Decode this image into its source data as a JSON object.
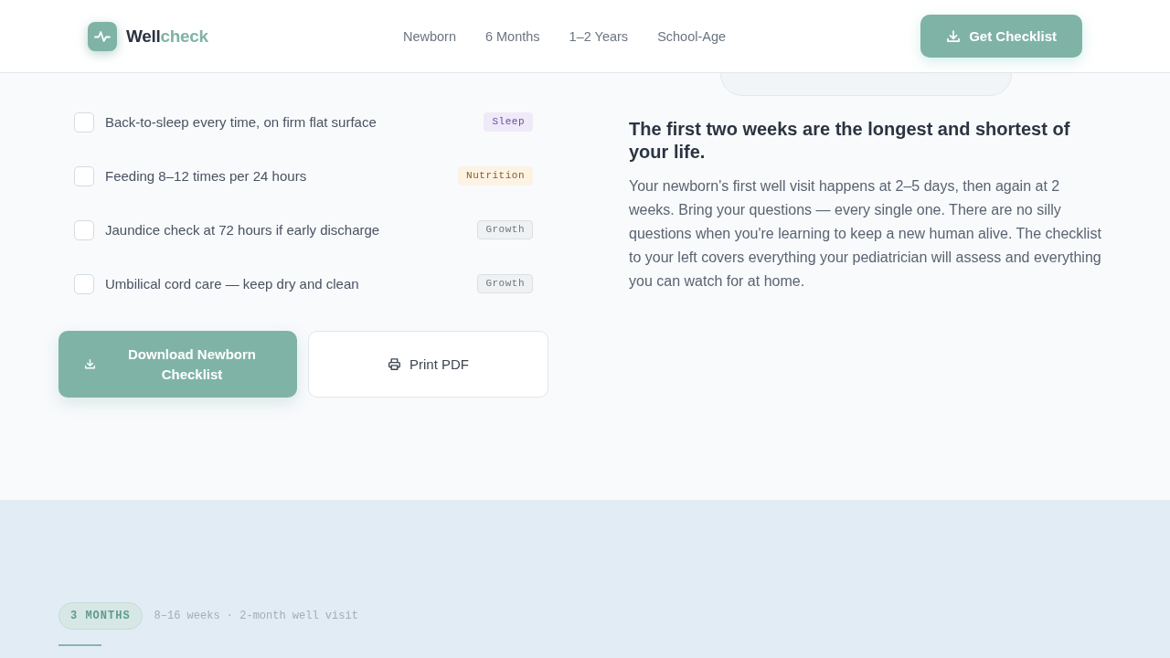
{
  "header": {
    "brand": {
      "name": "Well",
      "accent": "check"
    },
    "nav": [
      "Newborn",
      "6 Months",
      "1–2 Years",
      "School-Age"
    ],
    "cta": "Get Checklist"
  },
  "checklist": {
    "items": [
      {
        "text": "Back-to-sleep every time, on firm flat surface",
        "checked": false,
        "tag": {
          "label": "Sleep",
          "color": "#6b4aa6"
        }
      },
      {
        "text": "Feeding 8–12 times per 24 hours",
        "checked": false,
        "tag": {
          "label": "Nutrition",
          "color": "#8a5c1c"
        }
      },
      {
        "text": "Jaundice check at 72 hours if early discharge",
        "checked": false,
        "tag": {
          "label": "Growth",
          "color": "#6b7785"
        }
      },
      {
        "text": "Umbilical cord care — keep dry and clean",
        "checked": false,
        "tag": {
          "label": "Growth",
          "color": "#6b7785"
        }
      }
    ],
    "actions": {
      "primary": "Download Newborn Checklist",
      "secondary": "Print PDF"
    }
  },
  "intro": {
    "heading": "The first two weeks are the longest and shortest of your life.",
    "body": "Your newborn's first well visit happens at 2–5 days, then again at 2 weeks. Bring your questions — every single one. There are no silly questions when you're learning to keep a new human alive. The checklist to your left covers everything your pediatrician will assess and everything you can watch for at home."
  },
  "next_stage": {
    "badge": "3 MONTHS",
    "meta": "8–16 weeks · 2-month well visit"
  }
}
